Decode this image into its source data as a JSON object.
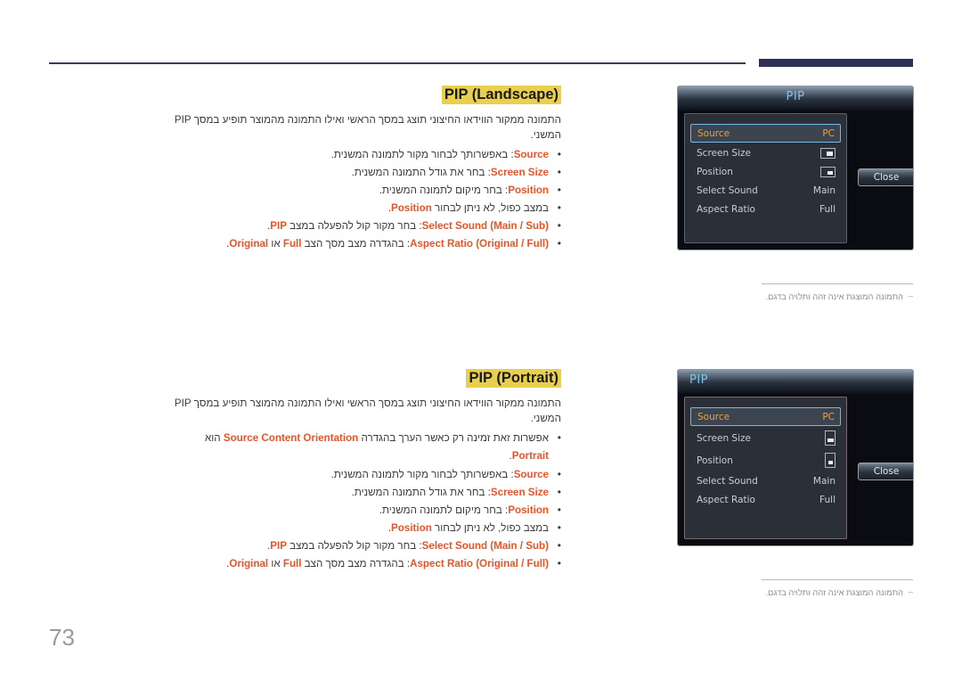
{
  "page": {
    "number": "73",
    "accent_highlight": "#e9cf4b",
    "accent_keyword": "#e8542a",
    "header_bar_color": "#2e3154"
  },
  "sections": [
    {
      "id": "landscape",
      "title": "PIP (Landscape)",
      "intro": "התמונה ממקור הווידאו החיצוני תוצג במסך הראשי ואילו התמונה מהמוצר תופיע במסך PIP המשני.",
      "bullets": [
        {
          "keyword": "Source",
          "text": ": באפשרותך לבחור מקור לתמונה המשנית."
        },
        {
          "keyword": "Screen Size",
          "text": ": בחר את גודל התמונה המשנית."
        },
        {
          "keyword": "Position",
          "text": ": בחר מיקום לתמונה המשנית."
        },
        {
          "note": true,
          "pre": "במצב כפול, לא ניתן לבחור ",
          "kw": "Position",
          "post": "."
        },
        {
          "keyword": "Select Sound (Main / Sub)",
          "text": ": בחר מקור קול להפעלה במצב ",
          "kw2": "PIP",
          "post2": "."
        },
        {
          "keyword": "Aspect Ratio (Original / Full)",
          "text": ": בהגדרה מצב מסך הצב ",
          "kw2": "Full",
          "mid": " או ",
          "kw3": "Original",
          "post2": "."
        }
      ],
      "caption": "התמונה המוצגת אינה זהה ותלויה בדגם.",
      "osd": {
        "title": "PIP",
        "title_align": "center",
        "rows": [
          {
            "label": "Source",
            "value": "PC",
            "selected": true,
            "icon": null
          },
          {
            "label": "Screen Size",
            "value": "",
            "selected": false,
            "icon": "screen-size-landscape-icon"
          },
          {
            "label": "Position",
            "value": "",
            "selected": false,
            "icon": "position-landscape-icon"
          },
          {
            "label": "Select Sound",
            "value": "Main",
            "selected": false,
            "icon": null
          },
          {
            "label": "Aspect Ratio",
            "value": "Full",
            "selected": false,
            "icon": null
          }
        ],
        "close_label": "Close"
      }
    },
    {
      "id": "portrait",
      "title": "PIP (Portrait)",
      "intro": "התמונה ממקור הווידאו החיצוני תוצג במסך הראשי ואילו התמונה מהמוצר תופיע במסך PIP המשני.",
      "top_note": {
        "pre": "אפשרות זאת זמינה רק כאשר הערך בהגדרה ",
        "kw": "Source Content Orientation",
        "mid": " הוא ",
        "kw2": "Portrait",
        "post": "."
      },
      "bullets": [
        {
          "keyword": "Source",
          "text": ": באפשרותך לבחור מקור לתמונה המשנית."
        },
        {
          "keyword": "Screen Size",
          "text": ": בחר את גודל התמונה המשנית."
        },
        {
          "keyword": "Position",
          "text": ": בחר מיקום לתמונה המשנית."
        },
        {
          "note": true,
          "pre": "במצב כפול, לא ניתן לבחור ",
          "kw": "Position",
          "post": "."
        },
        {
          "keyword": "Select Sound (Main / Sub)",
          "text": ": בחר מקור קול להפעלה במצב ",
          "kw2": "PIP",
          "post2": "."
        },
        {
          "keyword": "Aspect Ratio (Original / Full)",
          "text": ": בהגדרה מצב מסך הצב ",
          "kw2": "Full",
          "mid": " או ",
          "kw3": "Original",
          "post2": "."
        }
      ],
      "caption": "התמונה המוצגת אינה זהה ותלויה בדגם.",
      "osd": {
        "title": "PIP",
        "title_align": "left",
        "rows": [
          {
            "label": "Source",
            "value": "PC",
            "selected": true,
            "icon": null
          },
          {
            "label": "Screen Size",
            "value": "",
            "selected": false,
            "icon": "screen-size-portrait-icon"
          },
          {
            "label": "Position",
            "value": "",
            "selected": false,
            "icon": "position-portrait-icon"
          },
          {
            "label": "Select Sound",
            "value": "Main",
            "selected": false,
            "icon": null
          },
          {
            "label": "Aspect Ratio",
            "value": "Full",
            "selected": false,
            "icon": null
          }
        ],
        "close_label": "Close"
      }
    }
  ]
}
